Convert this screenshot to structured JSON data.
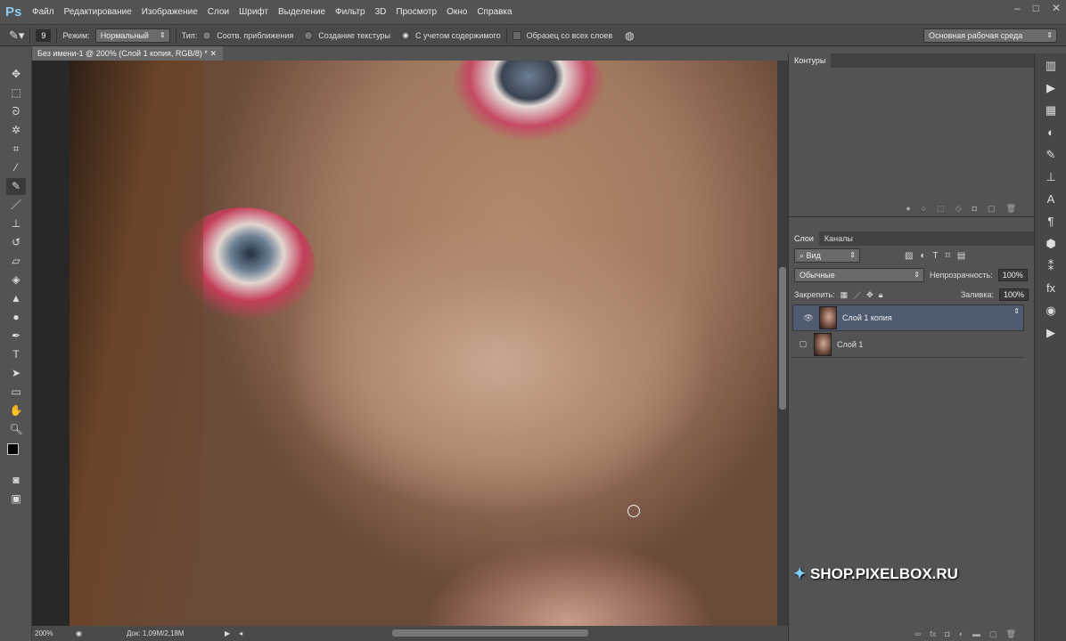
{
  "app": {
    "logo": "Ps"
  },
  "menu": [
    "Файл",
    "Редактирование",
    "Изображение",
    "Слои",
    "Шрифт",
    "Выделение",
    "Фильтр",
    "3D",
    "Просмотр",
    "Окно",
    "Справка"
  ],
  "options": {
    "brush_size": "9",
    "mode_label": "Режим:",
    "mode_value": "Нормальный",
    "type_label": "Тип:",
    "radio1": "Соотв. приближения",
    "radio2": "Создание текстуры",
    "radio3": "С учетом содержимого",
    "sample_all": "Образец со всех слоев",
    "workspace": "Основная рабочая среда"
  },
  "document": {
    "tab_title": "Без имени-1 @ 200% (Слой 1 копия, RGB/8) *",
    "zoom": "200%",
    "doc_info": "Док: 1,09M/2,18M"
  },
  "panels": {
    "contours": {
      "tab": "Контуры"
    },
    "layers": {
      "tab": "Слои",
      "tab2": "Каналы",
      "filter": "Вид",
      "blend_mode": "Обычные",
      "opacity_label": "Непрозрачность:",
      "opacity": "100%",
      "lock_label": "Закрепить:",
      "fill_label": "Заливка:",
      "fill": "100%",
      "items": [
        {
          "name": "Слой 1 копия",
          "visible": true,
          "selected": true
        },
        {
          "name": "Слой 1",
          "visible": false,
          "selected": false
        }
      ]
    }
  },
  "watermark": "SHOP.PIXELBOX.RU"
}
